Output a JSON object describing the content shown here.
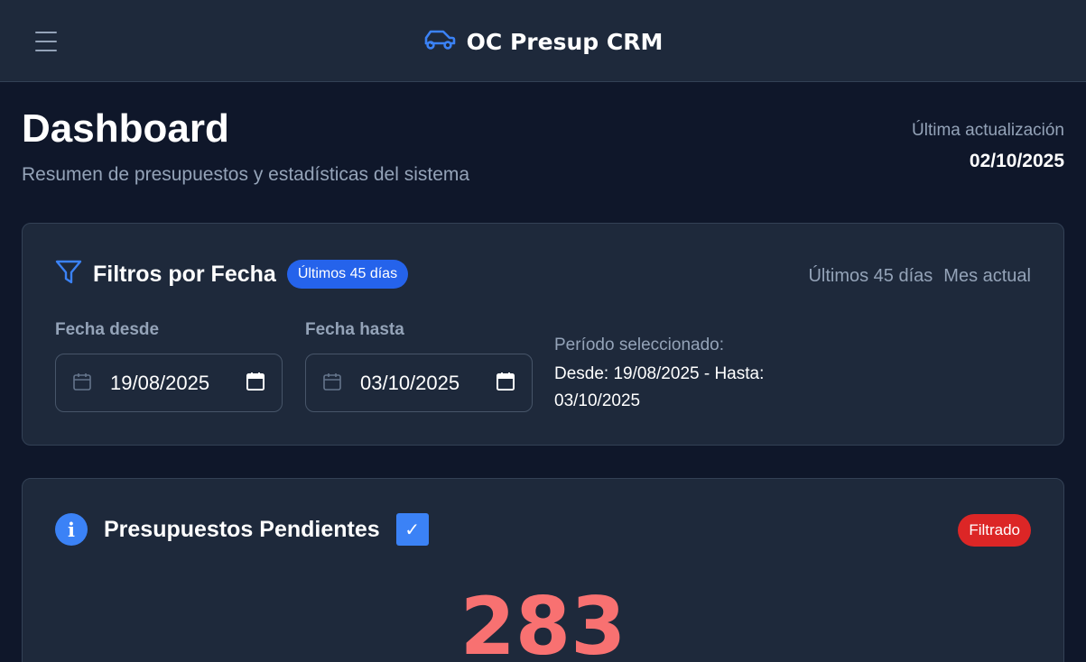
{
  "header": {
    "app_title": "OC Presup CRM",
    "menu_icon": "hamburger-icon",
    "logo_icon": "car-icon"
  },
  "page": {
    "title": "Dashboard",
    "subtitle": "Resumen de presupuestos y estadísticas del sistema",
    "last_update_label": "Última actualización",
    "last_update_date": "02/10/2025"
  },
  "filters": {
    "title": "Filtros por Fecha",
    "badge": "Últimos 45 días",
    "quick_links": [
      "Últimos 45 días",
      "Mes actual"
    ],
    "from_label": "Fecha desde",
    "from_value": "19/08/2025",
    "to_label": "Fecha hasta",
    "to_value": "03/10/2025",
    "period_label": "Período seleccionado:",
    "period_text": "Desde: 19/08/2025 - Hasta: 03/10/2025"
  },
  "pending": {
    "title": "Presupuestos Pendientes",
    "checkbox_mark": "✓",
    "badge": "Filtrado",
    "count": "283",
    "info_glyph": "i"
  },
  "colors": {
    "background": "#0f172a",
    "card": "#1e293b",
    "accent_blue": "#3b82f6",
    "badge_blue": "#2563eb",
    "badge_red": "#dc2626",
    "count_red": "#f87171",
    "muted_text": "#94a3b8"
  }
}
